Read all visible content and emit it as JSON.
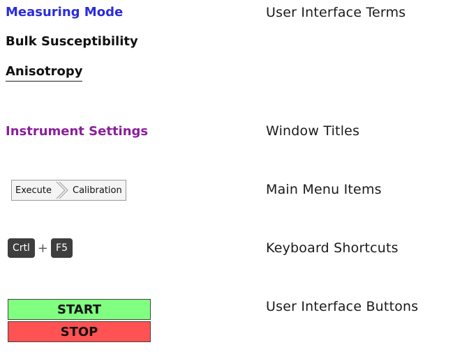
{
  "measuring_mode": {
    "title": "Measuring Mode",
    "options": [
      "Bulk Susceptibility",
      "Anisotropy"
    ],
    "description": "User Interface Terms"
  },
  "window_title": {
    "term": "Instrument Settings",
    "description": "Window Titles"
  },
  "main_menu": {
    "items": [
      "Execute",
      "Calibration"
    ],
    "description": "Main Menu Items"
  },
  "shortcut": {
    "keys": [
      "Crtl",
      "F5"
    ],
    "plus": "+",
    "description": "Keyboard Shortcuts"
  },
  "buttons": {
    "start_label": "START",
    "stop_label": "STOP",
    "description": "User Interface Buttons",
    "start_color": "#80ff80",
    "stop_color": "#ff5252"
  }
}
